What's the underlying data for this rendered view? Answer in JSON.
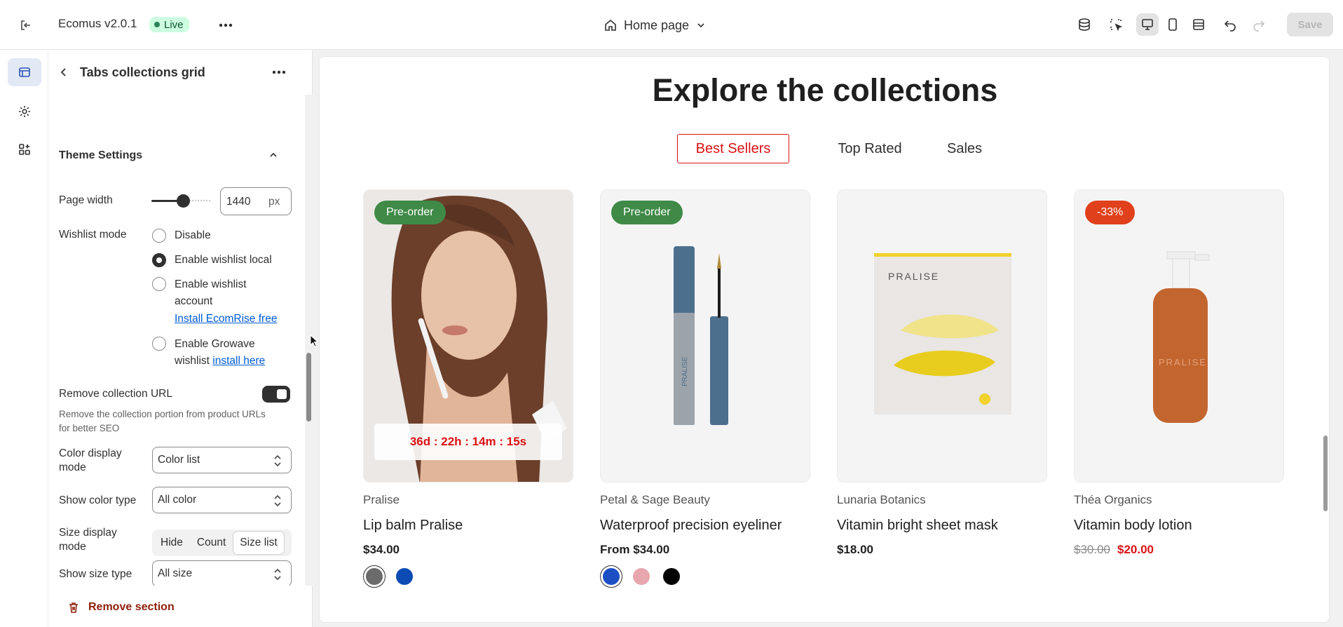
{
  "topbar": {
    "app_name": "Ecomus v2.0.1",
    "live_label": "Live",
    "page_label": "Home page",
    "save_label": "Save"
  },
  "panel": {
    "title": "Tabs collections grid",
    "group_title": "Theme Settings",
    "page_width": {
      "label": "Page width",
      "value": "1440",
      "unit": "px",
      "level_fraction": 0.58
    },
    "wishlist": {
      "label": "Wishlist mode",
      "options": [
        {
          "label": "Disable",
          "checked": false
        },
        {
          "label": "Enable wishlist local",
          "checked": true
        },
        {
          "label": "Enable wishlist",
          "label2": "account",
          "link": "Install EcomRise free",
          "checked": false
        },
        {
          "label": "Enable Growave",
          "label2": "wishlist",
          "link": "install here",
          "checked": false
        }
      ]
    },
    "remove_url": {
      "label": "Remove collection URL",
      "enabled": true,
      "help_line1": "Remove the collection portion from product URLs",
      "help_line2": "for better SEO"
    },
    "color_display": {
      "label1": "Color display",
      "label2": "mode",
      "value": "Color list"
    },
    "color_type": {
      "label": "Show color type",
      "value": "All color"
    },
    "size_display": {
      "label1": "Size display",
      "label2": "mode",
      "options": [
        "Hide",
        "Count",
        "Size list"
      ],
      "active": "Size list"
    },
    "size_type": {
      "label": "Show size type",
      "value": "All size"
    },
    "remove_section": "Remove section"
  },
  "preview": {
    "title": "Explore the collections",
    "tabs": [
      "Best Sellers",
      "Top Rated",
      "Sales"
    ],
    "active_tab": "Best Sellers",
    "products": [
      {
        "badge": "Pre-order",
        "badge_color": "#3f8a47",
        "brand": "Pralise",
        "name": "Lip balm Pralise",
        "price": "$34.00",
        "old_price": "",
        "timer": "36d : 22h : 14m : 15s",
        "swatches": [
          "#6b6b6b",
          "#0b4bb3"
        ]
      },
      {
        "badge": "Pre-order",
        "badge_color": "#3f8a47",
        "brand": "Petal & Sage Beauty",
        "name": "Waterproof precision eyeliner",
        "price": "From $34.00",
        "old_price": "",
        "timer": "",
        "swatches": [
          "#1d4fc4",
          "#e8a6ae",
          "#000000"
        ]
      },
      {
        "badge": "",
        "badge_color": "",
        "brand": "Lunaria Botanics",
        "name": "Vitamin bright sheet mask",
        "price": "$18.00",
        "old_price": "",
        "timer": "",
        "swatches": []
      },
      {
        "badge": "-33%",
        "badge_color": "#e0401c",
        "brand": "Théa Organics",
        "name": "Vitamin body lotion",
        "price": "$20.00",
        "old_price": "$30.00",
        "timer": "",
        "swatches": []
      }
    ],
    "product_image_text": "PRALISE"
  },
  "colors": {
    "accent_red": "#db1215",
    "badge_green": "#3f8a47",
    "badge_orange": "#e0401c"
  }
}
